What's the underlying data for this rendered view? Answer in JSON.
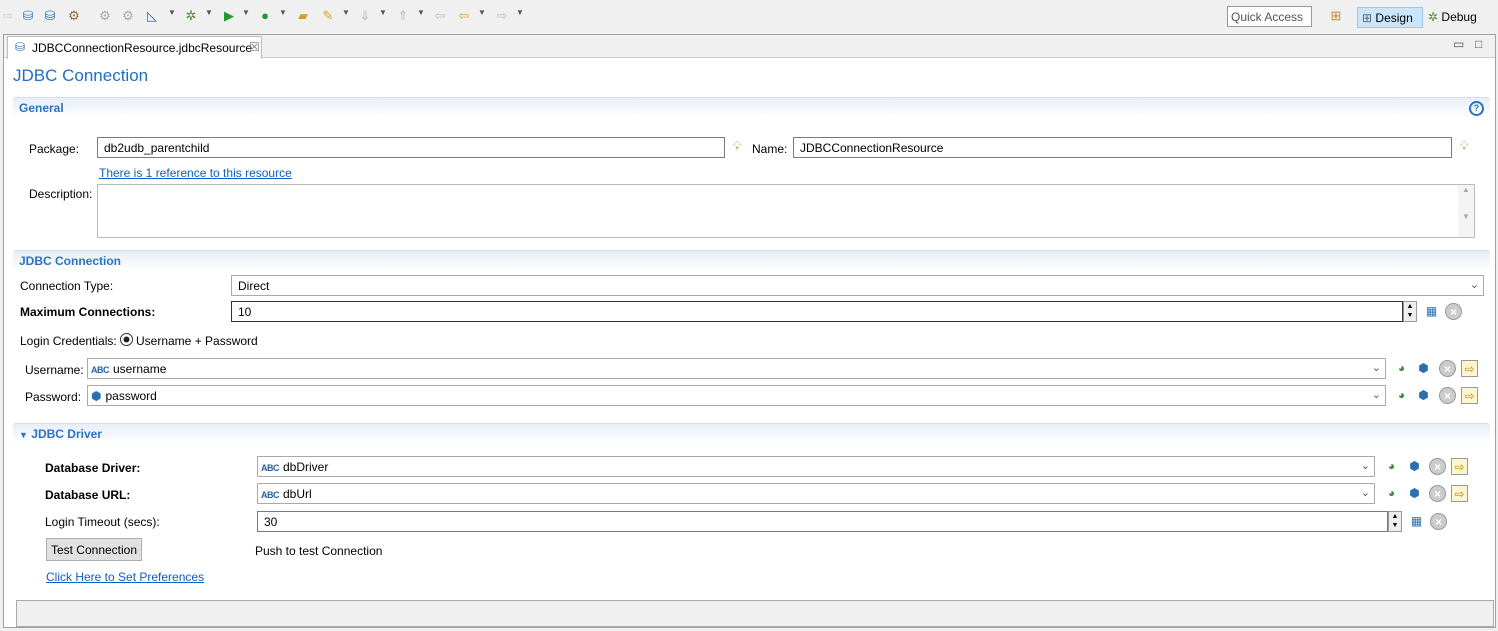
{
  "toolbar": {
    "quick_access": "Quick Access",
    "perspectives": [
      {
        "label": "Design"
      },
      {
        "label": "Debug"
      }
    ]
  },
  "editor_tab": {
    "label": "JDBCConnectionResource.jdbcResource"
  },
  "page_title": "JDBC Connection",
  "general": {
    "header": "General",
    "package_label": "Package:",
    "package_value": "db2udb_parentchild",
    "name_label": "Name:",
    "name_value": "JDBCConnectionResource",
    "reference_link": "There is 1 reference to this resource",
    "description_label": "Description:",
    "description_value": ""
  },
  "jdbc_connection": {
    "header": "JDBC Connection",
    "connection_type_label": "Connection Type:",
    "connection_type_value": "Direct",
    "max_connections_label": "Maximum Connections:",
    "max_connections_value": "10",
    "login_credentials_label": "Login Credentials:",
    "login_credentials_option": "Username + Password",
    "username_label": "Username:",
    "username_value": "username",
    "password_label": "Password:",
    "password_value": "password"
  },
  "jdbc_driver": {
    "header": "JDBC Driver",
    "driver_label": "Database Driver:",
    "driver_value": "dbDriver",
    "url_label": "Database URL:",
    "url_value": "dbUrl",
    "timeout_label": "Login Timeout (secs):",
    "timeout_value": "30",
    "test_button": "Test Connection",
    "test_hint": "Push to test Connection",
    "preferences_link": "Click Here to Set Preferences"
  },
  "abc": "ABC"
}
